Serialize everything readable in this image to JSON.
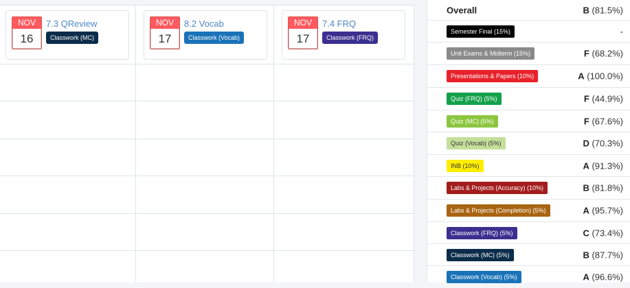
{
  "assignments": [
    {
      "month": "NOV",
      "day": "16",
      "title": "7.3 QReview",
      "tag": "Classwork (MC)",
      "tag_color": "#0b2c4a"
    },
    {
      "month": "NOV",
      "day": "17",
      "title": "8.2 Vocab",
      "tag": "Classwork (Vocab)",
      "tag_color": "#1a73b8"
    },
    {
      "month": "NOV",
      "day": "17",
      "title": "7.4 FRQ",
      "tag": "Classwork (FRQ)",
      "tag_color": "#3b2f8f"
    }
  ],
  "overall": {
    "label": "Overall",
    "letter": "B",
    "percent": "(81.5%)"
  },
  "categories": [
    {
      "name": "Semester Final (15%)",
      "letter": "",
      "percent": "-",
      "bg": "#000000",
      "fg": "#ffffff"
    },
    {
      "name": "Unit Exams & Midterm (15%)",
      "letter": "F",
      "percent": "(68.2%)",
      "bg": "#8a8a8a",
      "fg": "#ffffff"
    },
    {
      "name": "Presentations & Papers (10%)",
      "letter": "A",
      "percent": "(100.0%)",
      "bg": "#e8222c",
      "fg": "#ffffff"
    },
    {
      "name": "Quiz (FRQ) (5%)",
      "letter": "F",
      "percent": "(44.9%)",
      "bg": "#13a14a",
      "fg": "#ffffff"
    },
    {
      "name": "Quiz (MC) (5%)",
      "letter": "F",
      "percent": "(67.6%)",
      "bg": "#8cc63f",
      "fg": "#ffffff"
    },
    {
      "name": "Quiz (Vocab) (5%)",
      "letter": "D",
      "percent": "(70.3%)",
      "bg": "#c5df9a",
      "fg": "#333333"
    },
    {
      "name": "INB (10%)",
      "letter": "A",
      "percent": "(91.3%)",
      "bg": "#ffee00",
      "fg": "#333333"
    },
    {
      "name": "Labs & Projects (Accuracy) (10%)",
      "letter": "B",
      "percent": "(81.8%)",
      "bg": "#a31d1d",
      "fg": "#ffffff"
    },
    {
      "name": "Labs & Projects (Completion) (5%)",
      "letter": "A",
      "percent": "(95.7%)",
      "bg": "#a86410",
      "fg": "#ffffff"
    },
    {
      "name": "Classwork (FRQ) (5%)",
      "letter": "C",
      "percent": "(73.4%)",
      "bg": "#3b2f8f",
      "fg": "#ffffff"
    },
    {
      "name": "Classwork (MC) (5%)",
      "letter": "B",
      "percent": "(87.7%)",
      "bg": "#0b2c4a",
      "fg": "#ffffff"
    },
    {
      "name": "Classwork (Vocab) (5%)",
      "letter": "A",
      "percent": "(96.6%)",
      "bg": "#1a73b8",
      "fg": "#ffffff"
    }
  ]
}
